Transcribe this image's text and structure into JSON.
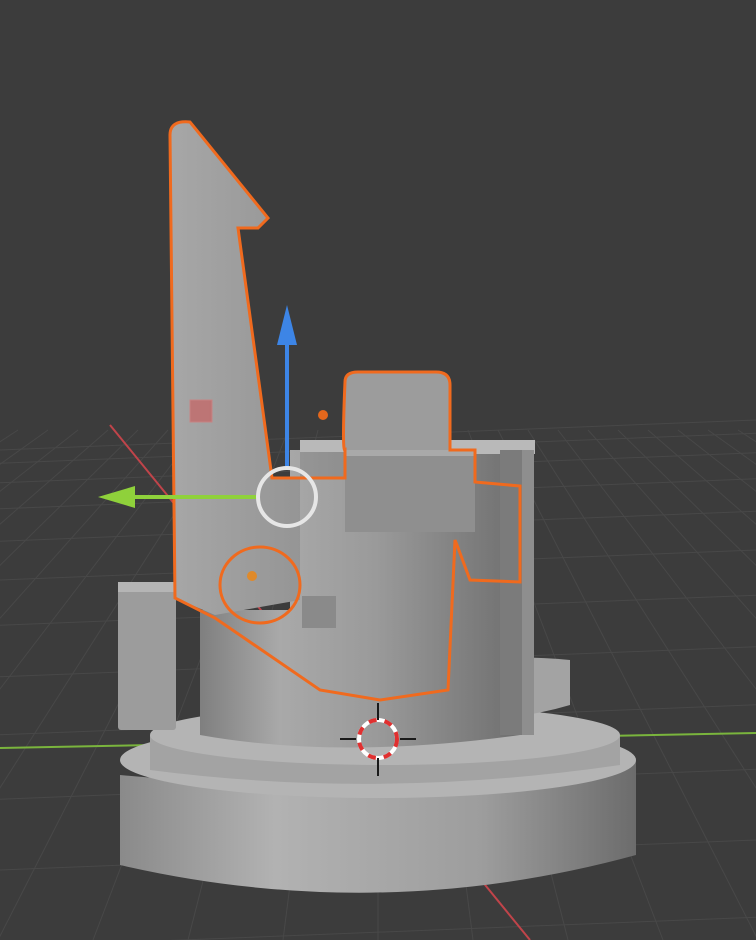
{
  "viewport": {
    "background_color": "#3c3c3c",
    "grid_color": "#484848",
    "x_axis_color": "#c0444a",
    "y_axis_color": "#7ab53d"
  },
  "selected_object": {
    "outline_color": "#f06a1e",
    "mesh_color": "#9c9c9c"
  },
  "gizmo": {
    "z_arrow_color": "#3d85e6",
    "y_arrow_color": "#8fd13b",
    "rotate_ring_color": "#e6e6e6",
    "origin_dot_color": "#e08a2a"
  },
  "icons": [
    "3d-cursor-icon",
    "light-marker-icon"
  ]
}
